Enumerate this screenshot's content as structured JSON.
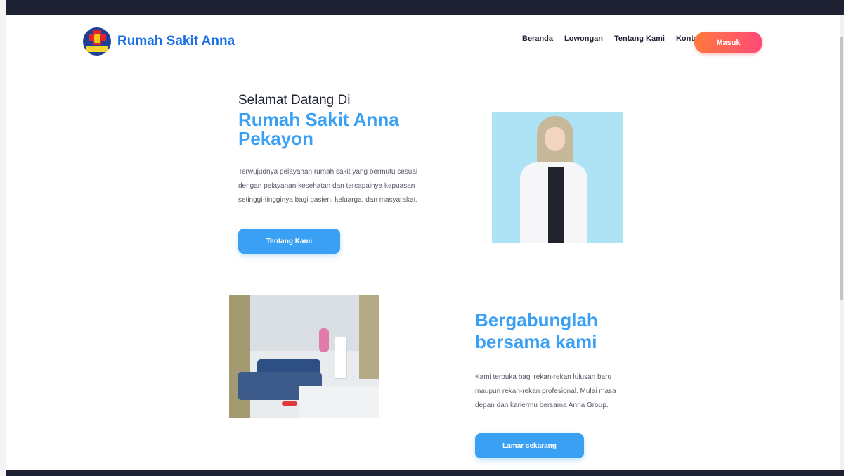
{
  "navbar": {
    "brand_name": "Rumah Sakit Anna",
    "links": [
      "Beranda",
      "Lowongan",
      "Tentang Kami",
      "Kontak"
    ],
    "login_label": "Masuk"
  },
  "hero": {
    "subtitle": "Selamat Datang Di",
    "title": "Rumah Sakit Anna Pekayon",
    "description": "Terwujudnya pelayanan rumah sakit yang bermutu sesuai dengan pelayanan kesehatan dan tercapainya kepuasan setinggi-tingginya bagi pasien, keluarga, dan masyarakat.",
    "button_label": "Tentang Kami"
  },
  "join": {
    "title": "Bergabunglah bersama kami",
    "description": "Kami terbuka bagi rekan-rekan lulusan baru maupun rekan-rekan profesional. Mulai masa depan dan kariermu bersama Anna Group.",
    "button_label": "Lamar sekarang"
  },
  "colors": {
    "accent_blue": "#3aa0f4",
    "brand_blue": "#1a6fe6",
    "login_gradient_start": "#ff7a3d",
    "login_gradient_end": "#ff4a78",
    "frame_dark": "#1f2233"
  }
}
